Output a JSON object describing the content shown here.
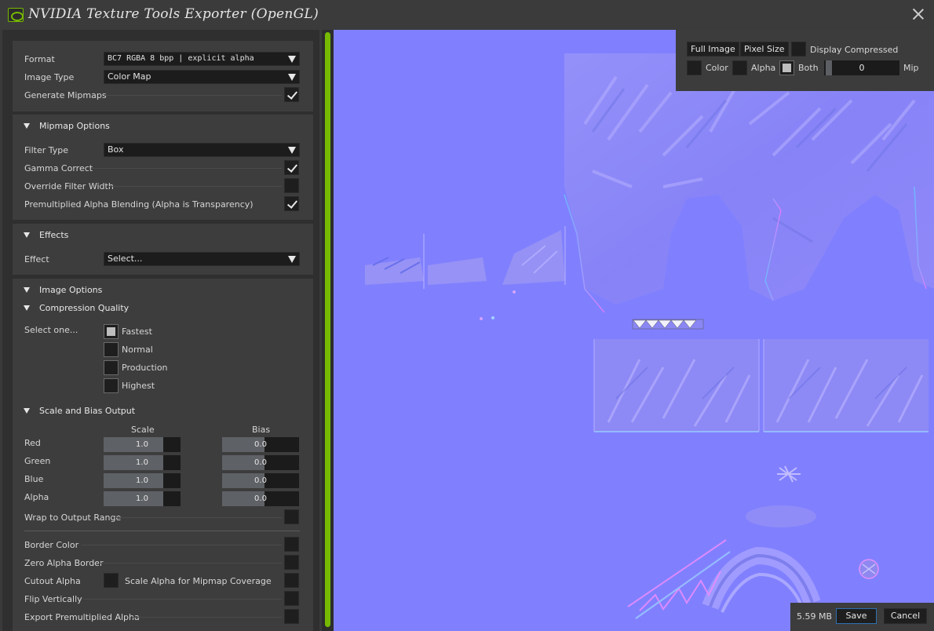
{
  "window": {
    "title": "NVIDIA Texture Tools Exporter (OpenGL)"
  },
  "general": {
    "format_label": "Format",
    "format_value": "BC7      RGBA   8 bpp | explicit alpha",
    "image_type_label": "Image Type",
    "image_type_value": "Color Map",
    "generate_mipmaps_label": "Generate Mipmaps",
    "generate_mipmaps_checked": true
  },
  "mipmap_options": {
    "header": "Mipmap Options",
    "filter_type_label": "Filter Type",
    "filter_type_value": "Box",
    "gamma_correct_label": "Gamma Correct",
    "gamma_correct_checked": true,
    "override_filter_width_label": "Override Filter Width",
    "override_filter_width_checked": false,
    "premultiplied_label": "Premultiplied Alpha Blending (Alpha is Transparency)",
    "premultiplied_checked": true
  },
  "effects": {
    "header": "Effects",
    "effect_label": "Effect",
    "effect_value": "Select..."
  },
  "image_options": {
    "header": "Image Options",
    "compression_quality_header": "Compression Quality",
    "select_label": "Select one...",
    "quality_options": [
      "Fastest",
      "Normal",
      "Production",
      "Highest"
    ],
    "quality_selected": "Fastest",
    "scale_bias_header": "Scale and Bias Output",
    "scale_col": "Scale",
    "bias_col": "Bias",
    "channels": [
      {
        "name": "Red",
        "scale": "1.0",
        "bias": "0.0"
      },
      {
        "name": "Green",
        "scale": "1.0",
        "bias": "0.0"
      },
      {
        "name": "Blue",
        "scale": "1.0",
        "bias": "0.0"
      },
      {
        "name": "Alpha",
        "scale": "1.0",
        "bias": "0.0"
      }
    ],
    "wrap_label": "Wrap to Output Range",
    "border_color_label": "Border Color",
    "zero_alpha_border_label": "Zero Alpha Border",
    "cutout_alpha_label": "Cutout Alpha",
    "scale_alpha_label": "Scale Alpha for Mipmap Coverage",
    "flip_vertically_label": "Flip Vertically",
    "export_premultiplied_label": "Export Premultiplied Alpha"
  },
  "viewer": {
    "full_image": "Full Image",
    "pixel_size": "Pixel Size",
    "display_compressed": "Display Compressed",
    "color": "Color",
    "alpha": "Alpha",
    "both": "Both",
    "mip_value": "0",
    "mip_label": "Mip",
    "both_selected": true
  },
  "footer": {
    "file_size": "5.59 MB",
    "save": "Save",
    "cancel": "Cancel"
  },
  "colors": {
    "accent_green": "#76b900",
    "normal_map_base": "#8080ff",
    "save_border": "#2e6fb0"
  }
}
